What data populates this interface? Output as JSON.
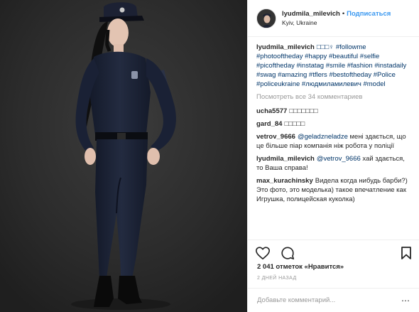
{
  "post": {
    "username": "lyudmila_milevich",
    "follow_label": "Подписаться",
    "location": "Kyiv, Ukraine",
    "caption": "□□□♀ #followme #photooftheday #happy #beautiful #selfie #picoftheday #instatag #smile #fashion #instadaily #swag #amazing #tflers #bestoftheday #Police #policeukraine #людмиламилевич #model",
    "view_all": "Посмотреть все 34 комментариев",
    "likes": "2 041 отметок «Нравится»",
    "time_ago": "2 ДНЕЙ НАЗАД",
    "add_comment_placeholder": "Добавьте комментарий...",
    "more_glyph": "⋯"
  },
  "comments": [
    {
      "user": "ucha5577",
      "text": "□□□□□□□"
    },
    {
      "user": "gard_84",
      "text": "□□□□□"
    },
    {
      "user": "vetrov_9666",
      "mention": "@geladzneladze",
      "text": " мені здається, що це більше піар компанія ніж робота у поліції"
    },
    {
      "user": "lyudmila_milevich",
      "mention": "@vetrov_9666",
      "text": " хай здається, то Ваша справа!"
    },
    {
      "user": "max_kurachinsky",
      "text": "Видела когда нибудь барби?) Это фото, это моделька) такое впечатление как Игрушка, полицейская куколка)"
    }
  ],
  "icons": {
    "like": "heart-icon",
    "comment": "comment-icon",
    "save": "bookmark-icon",
    "options": "more-options-icon"
  }
}
